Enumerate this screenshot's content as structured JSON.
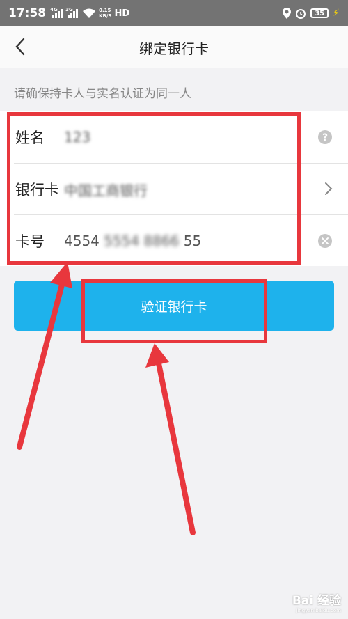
{
  "status_bar": {
    "time": "17:58",
    "signal1_tag": "4G",
    "signal2_tag": "3G",
    "speed_value": "0.15",
    "speed_unit": "KB/S",
    "network": "HD",
    "battery": "35"
  },
  "header": {
    "title": "绑定银行卡",
    "back_icon": "chevron-left-icon"
  },
  "tip": "请确保持卡人与实名认证为同一人",
  "form": {
    "name": {
      "label": "姓名",
      "value": "123",
      "icon": "question-icon"
    },
    "bank": {
      "label": "银行卡",
      "value": "中国工商银行",
      "icon": "chevron-right-icon"
    },
    "card_no": {
      "label": "卡号",
      "value_visible_start": "4554",
      "value_blurred": "5554 8866",
      "value_visible_end": "55",
      "icon": "clear-icon"
    }
  },
  "submit_button": "验证银行卡",
  "watermark": {
    "brand": "Bai 经验",
    "url": "jingyan.baidu.com"
  },
  "colors": {
    "accent": "#1eb2ec",
    "annotation": "#e8373d",
    "status_bar": "#737373",
    "background": "#f2f2f4"
  }
}
